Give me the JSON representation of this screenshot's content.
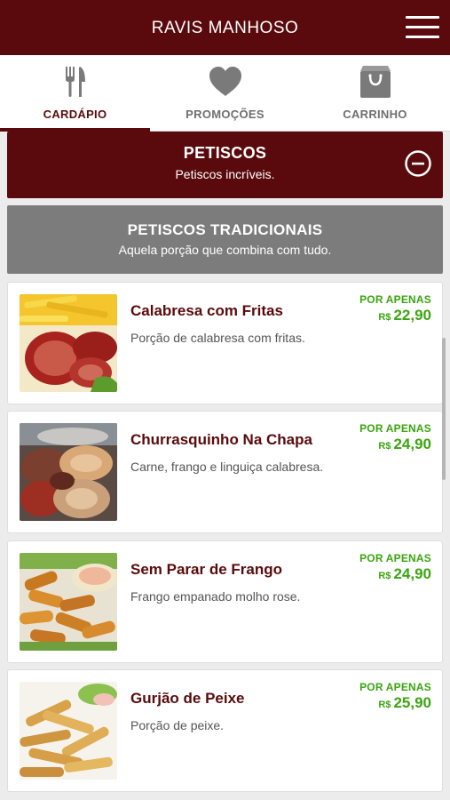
{
  "header": {
    "title": "RAVIS MANHOSO"
  },
  "tabs": [
    {
      "label": "CARDÁPIO",
      "icon": "fork-knife-icon",
      "active": true
    },
    {
      "label": "PROMOÇÕES",
      "icon": "heart-icon",
      "active": false
    },
    {
      "label": "CARRINHO",
      "icon": "shopping-bag-icon",
      "active": false
    }
  ],
  "section": {
    "title": "PETISCOS",
    "subtitle": "Petiscos incríveis.",
    "collapse_icon": "minus-circle-icon"
  },
  "subsection": {
    "title": "PETISCOS TRADICIONAIS",
    "subtitle": "Aquela porção que combina com tudo."
  },
  "products": [
    {
      "name": "Calabresa com Fritas",
      "description": "Porção de calabresa com fritas.",
      "promo": "POR APENAS",
      "currency": "R$",
      "price": "22,90"
    },
    {
      "name": "Churrasquinho Na Chapa",
      "description": "Carne, frango e linguiça calabresa.",
      "promo": "POR APENAS",
      "currency": "R$",
      "price": "24,90"
    },
    {
      "name": "Sem Parar de Frango",
      "description": "Frango empanado molho rose.",
      "promo": "POR APENAS",
      "currency": "R$",
      "price": "24,90"
    },
    {
      "name": "Gurjão de Peixe",
      "description": "Porção de peixe.",
      "promo": "POR APENAS",
      "currency": "R$",
      "price": "25,90"
    }
  ],
  "colors": {
    "brand": "#5a0a0c",
    "price": "#3aa50f",
    "subsection_bg": "#7c7c7c"
  }
}
